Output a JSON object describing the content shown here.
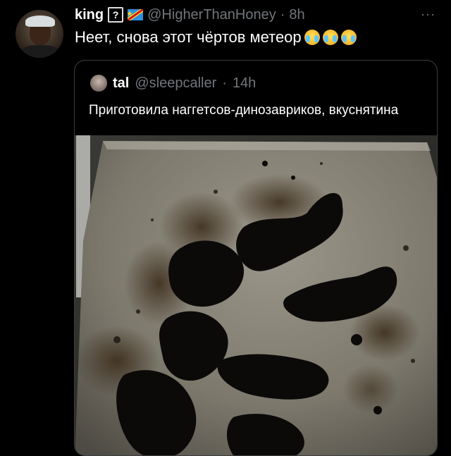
{
  "tweet": {
    "author_name": "king",
    "question_glyph": "?",
    "handle": "@HigherThanHoney",
    "separator": "·",
    "time": "8h",
    "text": "Неет, снова этот чёртов метеор",
    "more": "···",
    "emoji_count": 3
  },
  "quoted": {
    "author_name": "tal",
    "handle": "@sleepcaller",
    "separator": "·",
    "time": "14h",
    "text": "Приготовила наггетсов-динозавриков, вкуснятина"
  },
  "icons": {
    "flag": "flag-icon",
    "emoji": "loudly-crying-face-icon",
    "more": "more-icon"
  }
}
